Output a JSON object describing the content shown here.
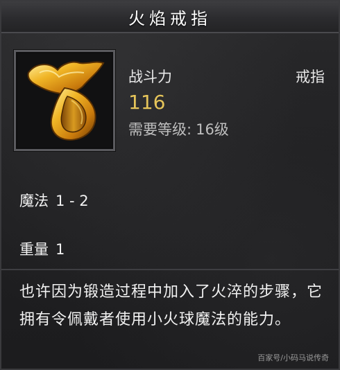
{
  "item": {
    "title": "火焰戒指",
    "icon": "fire-ring-icon",
    "combat_power_label": "战斗力",
    "combat_power_value": "116",
    "type": "戒指",
    "required_level_label": "需要等级:",
    "required_level_value": "16级",
    "stats": {
      "magic_label": "魔法",
      "magic_value": "1 - 2",
      "weight_label": "重量",
      "weight_value": "1"
    },
    "description": "也许因为锻造过程中加入了火淬的步骤，它拥有令佩戴者使用小火球魔法的能力。"
  },
  "watermark": "百家号/小码马说传奇",
  "colors": {
    "power_value": "#e6c55a",
    "ring_gold": "#e8a216",
    "background": "#1f1f21"
  }
}
